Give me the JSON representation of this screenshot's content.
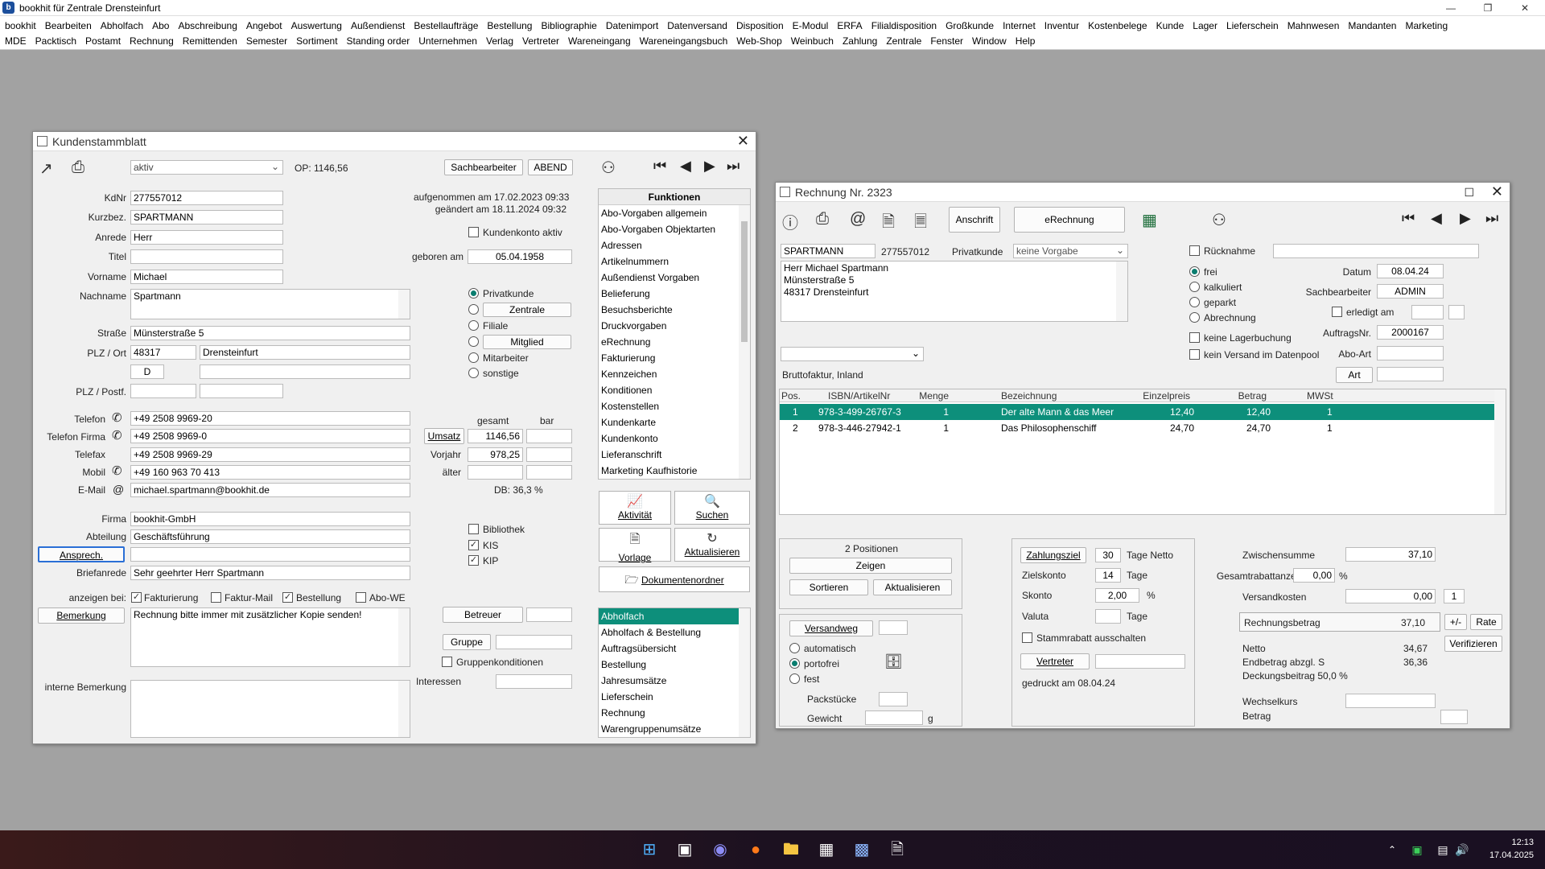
{
  "app": {
    "title": "bookhit für Zentrale Drensteinfurt"
  },
  "menu": {
    "row1": [
      "bookhit",
      "Bearbeiten",
      "Abholfach",
      "Abo",
      "Abschreibung",
      "Angebot",
      "Auswertung",
      "Außendienst",
      "Bestellaufträge",
      "Bestellung",
      "Bibliographie",
      "Datenimport",
      "Datenversand",
      "Disposition",
      "E-Modul",
      "ERFA",
      "Filialdisposition",
      "Großkunde",
      "Internet",
      "Inventur",
      "Kostenbelege",
      "Kunde",
      "Lager",
      "Lieferschein",
      "Mahnwesen",
      "Mandanten",
      "Marketing"
    ],
    "row2": [
      "MDE",
      "Packtisch",
      "Postamt",
      "Rechnung",
      "Remittenden",
      "Semester",
      "Sortiment",
      "Standing order",
      "Unternehmen",
      "Verlag",
      "Vertreter",
      "Wareneingang",
      "Wareneingangsbuch",
      "Web-Shop",
      "Weinbuch",
      "Zahlung",
      "Zentrale",
      "Fenster",
      "Window",
      "Help"
    ]
  },
  "kunden": {
    "title": "Kundenstammblatt",
    "status": "aktiv",
    "op": "OP: 1146,56",
    "sachbearbeiter_btn": "Sachbearbeiter",
    "abend_btn": "ABEND",
    "labels": {
      "kdnr": "KdNr",
      "kurzbez": "Kurzbez.",
      "anrede": "Anrede",
      "titel": "Titel",
      "vorname": "Vorname",
      "nachname": "Nachname",
      "strasse": "Straße",
      "plzort": "PLZ / Ort",
      "plzpostf": "PLZ / Postf.",
      "telefon": "Telefon",
      "telefonfirma": "Telefon Firma",
      "telefax": "Telefax",
      "mobil": "Mobil",
      "email": "E-Mail",
      "firma": "Firma",
      "abteilung": "Abteilung",
      "briefanrede": "Briefanrede",
      "anzeigen": "anzeigen bei:",
      "interne": "interne Bemerkung",
      "geboren": "geboren am",
      "gesamt": "gesamt",
      "bar": "bar",
      "vorjahr": "Vorjahr",
      "aelter": "älter",
      "interessen": "Interessen"
    },
    "values": {
      "kdnr": "277557012",
      "kurzbez": "SPARTMANN",
      "anrede": "Herr",
      "titel": "",
      "vorname": "Michael",
      "nachname": "Spartmann",
      "strasse": "Münsterstraße 5",
      "plz": "48317",
      "ort": "Drensteinfurt",
      "land": "D",
      "telefon": "+49 2508 9969-20",
      "telefonfirma": "+49 2508 9969-0",
      "telefax": "+49 2508 9969-29",
      "mobil": "+49 160 963 70 413",
      "email": "michael.spartmann@bookhit.de",
      "firma": "bookhit-GmbH",
      "abteilung": "Geschäftsführung",
      "ansprech": "",
      "briefanrede": "Sehr geehrter Herr Spartmann",
      "bemerkung": "Rechnung bitte immer mit zusätzlicher Kopie senden!",
      "geboren": "05.04.1958",
      "umsatz_gesamt": "1146,56",
      "vorjahr": "978,25",
      "db": "DB: 36,3 %"
    },
    "aufgenommen": "aufgenommen am 17.02.2023 09:33",
    "geaendert": "geändert am 18.11.2024 09:32",
    "kundenkonto": "Kundenkonto aktiv",
    "types": [
      "Privatkunde",
      "Zentrale",
      "Filiale",
      "Mitglied",
      "Mitarbeiter",
      "sonstige"
    ],
    "ansprech_btn": "Ansprech.",
    "bemerkung_btn": "Bemerkung",
    "umsatz_btn": "Umsatz",
    "anzeigen": [
      "Fakturierung",
      "Faktur-Mail",
      "Bestellung",
      "Abo-WE"
    ],
    "flags": [
      "Bibliothek",
      "KIS",
      "KIP"
    ],
    "betreuer_btn": "Betreuer",
    "gruppe_btn": "Gruppe",
    "gruppenkond": "Gruppenkonditionen",
    "funktionen_title": "Funktionen",
    "funktionen": [
      "Abo-Vorgaben allgemein",
      "Abo-Vorgaben Objektarten",
      "Adressen",
      "Artikelnummern",
      "Außendienst Vorgaben",
      "Belieferung",
      "Besuchsberichte",
      "Druckvorgaben",
      "eRechnung",
      "Fakturierung",
      "Kennzeichen",
      "Konditionen",
      "Kostenstellen",
      "Kundenkarte",
      "Kundenkonto",
      "Lieferanschrift",
      "Marketing Kaufhistorie"
    ],
    "actions": [
      "Aktivität",
      "Suchen",
      "Vorlage",
      "Aktualisieren"
    ],
    "dokordner": "Dokumentenordner",
    "lower_list": [
      "Abholfach",
      "Abholfach & Bestellung",
      "Auftragsübersicht",
      "Bestellung",
      "Jahresumsätze",
      "Lieferschein",
      "Rechnung",
      "Warengruppenumsätze"
    ]
  },
  "rechnung": {
    "title": "Rechnung Nr. 2323",
    "anschrift_btn": "Anschrift",
    "erechnung_btn": "eRechnung",
    "kurz": "SPARTMANN",
    "kdnr": "277557012",
    "kundenart": "Privatkunde",
    "vorgabe": "keine Vorgabe",
    "address": [
      "Herr Michael Spartmann",
      "Münsterstraße 5",
      "48317 Drensteinfurt"
    ],
    "faktur": "Bruttofaktur, Inland",
    "ruecknahme": "Rücknahme",
    "status": [
      "frei",
      "kalkuliert",
      "geparkt",
      "Abrechnung"
    ],
    "keine_lager": "keine Lagerbuchung",
    "kein_versand": "kein Versand im Datenpool",
    "datum_lbl": "Datum",
    "datum": "08.04.24",
    "sachb_lbl": "Sachbearbeiter",
    "sachb": "ADMIN",
    "erledigt": "erledigt am",
    "auftrag_lbl": "AuftragsNr.",
    "auftrag": "2000167",
    "aboart": "Abo-Art",
    "art_btn": "Art",
    "columns": [
      "Pos.",
      "ISBN/ArtikelNr",
      "Menge",
      "Bezeichnung",
      "Einzelpreis",
      "Betrag",
      "MWSt"
    ],
    "rows": [
      [
        "1",
        "978-3-499-26767-3",
        "1",
        "Der alte Mann & das Meer",
        "12,40",
        "12,40",
        "1"
      ],
      [
        "2",
        "978-3-446-27942-1",
        "1",
        "Das Philosophenschiff",
        "24,70",
        "24,70",
        "1"
      ]
    ],
    "positionen": "2 Positionen",
    "zeigen": "Zeigen",
    "sortieren": "Sortieren",
    "aktualisieren": "Aktualisieren",
    "versandweg": "Versandweg",
    "versand_opts": [
      "automatisch",
      "portofrei",
      "fest"
    ],
    "packstuecke": "Packstücke",
    "gewicht": "Gewicht",
    "g": "g",
    "zahlungsziel_btn": "Zahlungsziel",
    "zahlungsziel": "30",
    "tage_netto": "Tage Netto",
    "zielskonto_lbl": "Zielskonto",
    "zielskonto": "14",
    "tage": "Tage",
    "skonto_lbl": "Skonto",
    "skonto": "2,00",
    "pct": "%",
    "valuta_lbl": "Valuta",
    "stammrabatt": "Stammrabatt ausschalten",
    "vertreter_btn": "Vertreter",
    "gedruckt": "gedruckt am 08.04.24",
    "zwischensumme_lbl": "Zwischensumme",
    "zwischensumme": "37,10",
    "gesamtrabatt_lbl": "Gesamtrabattanzeiget",
    "gesamtrabatt": "0,00",
    "versandkosten_lbl": "Versandkosten",
    "versandkosten": "0,00",
    "versand_n": "1",
    "rechnungsbetrag_lbl": "Rechnungsbetrag",
    "rechnungsbetrag": "37,10",
    "pm_btn": "+/-",
    "rate_btn": "Rate",
    "verifizieren_btn": "Verifizieren",
    "netto_lbl": "Netto",
    "netto": "34,67",
    "endbetrag_lbl": "Endbetrag abzgl. S",
    "endbetrag": "36,36",
    "deckung": "Deckungsbeitrag 50,0 %",
    "wechselkurs": "Wechselkurs",
    "betrag": "Betrag"
  },
  "taskbar": {
    "time": "12:13",
    "date": "17.04.2025"
  }
}
